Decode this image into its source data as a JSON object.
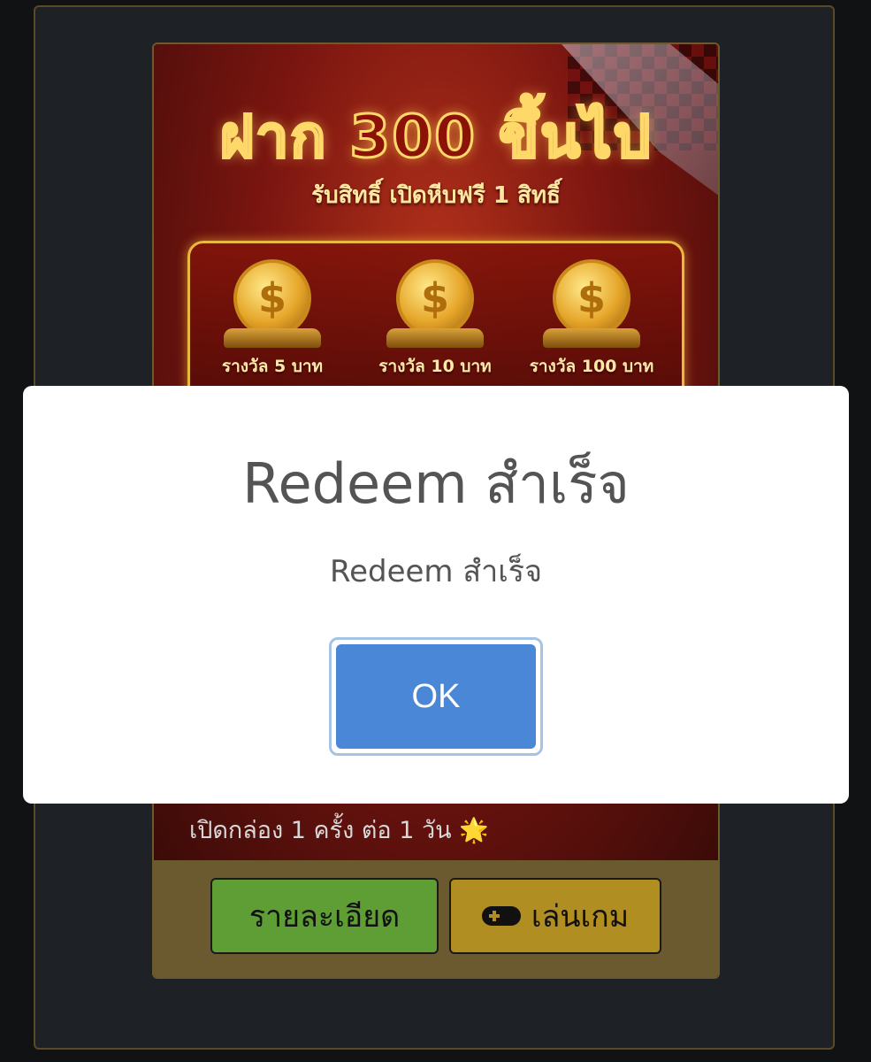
{
  "promo": {
    "title": "ฝาก 300 ขึ้นไป",
    "subtitle": "รับสิทธิ์ เปิดหีบฟรี 1 สิทธิ์",
    "prizes": [
      {
        "coin": "$",
        "label": "รางวัล 5 บาท"
      },
      {
        "coin": "$",
        "label": "รางวัล 10 บาท"
      },
      {
        "coin": "$",
        "label": "รางวัล 100 บาท"
      }
    ],
    "description": "เปิดกล่อง 1 ครั้ง ต่อ 1 วัน 🌟",
    "description_partial": ""
  },
  "footer": {
    "details_label": "รายละเอียด",
    "play_label": "เล่นเกม"
  },
  "dialog": {
    "title": "Redeem สำเร็จ",
    "message": "Redeem สำเร็จ",
    "ok_label": "OK"
  },
  "icons": {
    "play_button_icon": "gamepad-icon",
    "prize_icon": "coin-icon"
  },
  "colors": {
    "ok_button": "#4a87d6",
    "details_button": "#5f9e35",
    "play_button": "#b08e22"
  }
}
